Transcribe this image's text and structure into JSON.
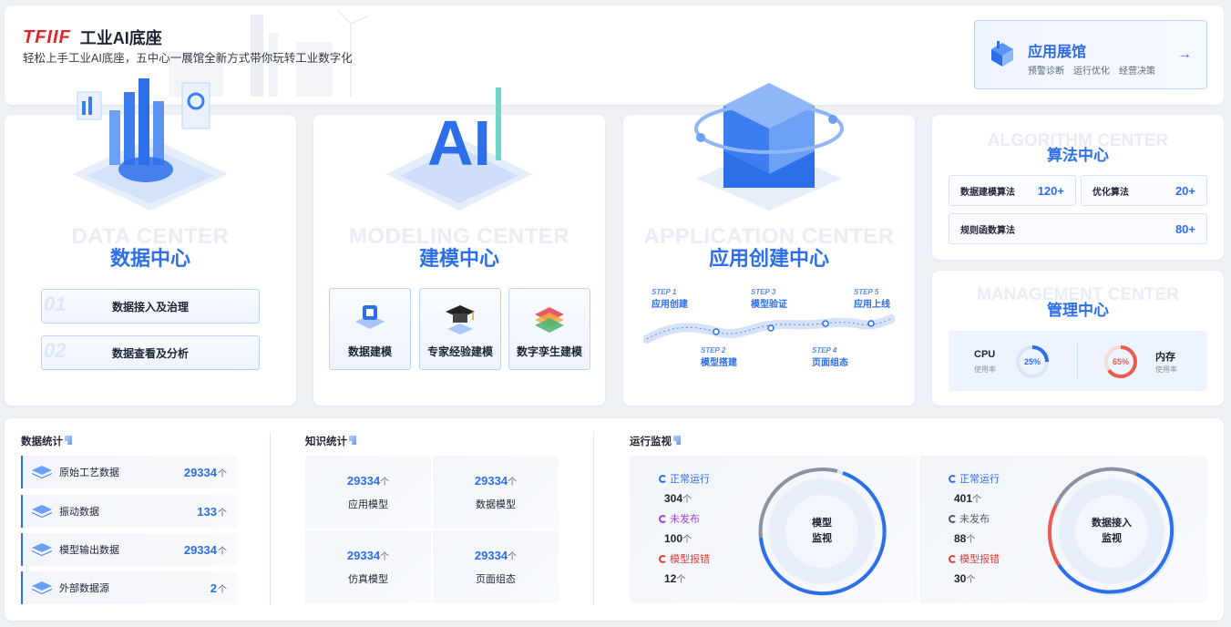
{
  "header": {
    "logo_text": "TFIIF",
    "app_name": "工业AI底座",
    "subtitle": "轻松上手工业AI底座，五中心一展馆全新方式带你玩转工业数字化",
    "expo": {
      "title": "应用展馆",
      "tags": [
        "预警诊断",
        "运行优化",
        "经营决策"
      ]
    }
  },
  "data_center": {
    "watermark": "DATA CENTER",
    "title": "数据中心",
    "items": [
      {
        "num": "01",
        "label": "数据接入及治理"
      },
      {
        "num": "02",
        "label": "数据查看及分析"
      }
    ]
  },
  "modeling_center": {
    "watermark": "MODELING CENTER",
    "title": "建模中心",
    "items": [
      {
        "label": "数据建模",
        "icon": "data-modeling-icon"
      },
      {
        "label": "专家经验建模",
        "icon": "expert-cap-icon"
      },
      {
        "label": "数字孪生建模",
        "icon": "digital-twin-icon"
      }
    ]
  },
  "application_center": {
    "watermark": "APPLICATION CENTER",
    "title": "应用创建中心",
    "steps": [
      {
        "num": "STEP 1",
        "label": "应用创建"
      },
      {
        "num": "STEP 2",
        "label": "模型搭建"
      },
      {
        "num": "STEP 3",
        "label": "模型验证"
      },
      {
        "num": "STEP 4",
        "label": "页面组态"
      },
      {
        "num": "STEP 5",
        "label": "应用上线"
      }
    ]
  },
  "algorithm_center": {
    "watermark": "ALGORITHM CENTER",
    "title": "算法中心",
    "items": [
      {
        "label": "数据建模算法",
        "value": "120+"
      },
      {
        "label": "优化算法",
        "value": "20+"
      },
      {
        "label": "规则函数算法",
        "value": "80+"
      }
    ]
  },
  "management_center": {
    "watermark": "MANAGEMENT CENTER",
    "title": "管理中心",
    "cpu": {
      "label": "CPU",
      "sub": "使用率",
      "percent": 25,
      "text": "25%",
      "color": "#2d6fe8"
    },
    "memory": {
      "label": "内存",
      "sub": "使用率",
      "percent": 65,
      "text": "65%",
      "color": "#ec5b52"
    }
  },
  "data_stats": {
    "title": "数据统计",
    "rows": [
      {
        "label": "原始工艺数据",
        "value": "29334",
        "unit": "个"
      },
      {
        "label": "振动数据",
        "value": "133",
        "unit": "个"
      },
      {
        "label": "模型输出数据",
        "value": "29334",
        "unit": "个"
      },
      {
        "label": "外部数据源",
        "value": "2",
        "unit": "个"
      }
    ]
  },
  "knowledge_stats": {
    "title": "知识统计",
    "cells": [
      {
        "label": "应用模型",
        "value": "29334",
        "unit": "个"
      },
      {
        "label": "数据模型",
        "value": "29334",
        "unit": "个"
      },
      {
        "label": "仿真模型",
        "value": "29334",
        "unit": "个"
      },
      {
        "label": "页面组态",
        "value": "29334",
        "unit": "个"
      }
    ]
  },
  "run_monitor": {
    "title": "运行监视",
    "panels": [
      {
        "ring_label_1": "模型",
        "ring_label_2": "监视",
        "items": [
          {
            "label": "正常运行",
            "value": "304",
            "unit": "个",
            "color": "#2d6fe8"
          },
          {
            "label": "未发布",
            "value": "100",
            "unit": "个",
            "color": "#9a46d8"
          },
          {
            "label": "模型报错",
            "value": "12",
            "unit": "个",
            "color": "#e0403a"
          }
        ]
      },
      {
        "ring_label_1": "数据接入",
        "ring_label_2": "监视",
        "items": [
          {
            "label": "正常运行",
            "value": "401",
            "unit": "个",
            "color": "#2d6fe8"
          },
          {
            "label": "未发布",
            "value": "88",
            "unit": "个",
            "color": "#555b66"
          },
          {
            "label": "模型报错",
            "value": "30",
            "unit": "个",
            "color": "#e0403a"
          }
        ]
      }
    ]
  }
}
